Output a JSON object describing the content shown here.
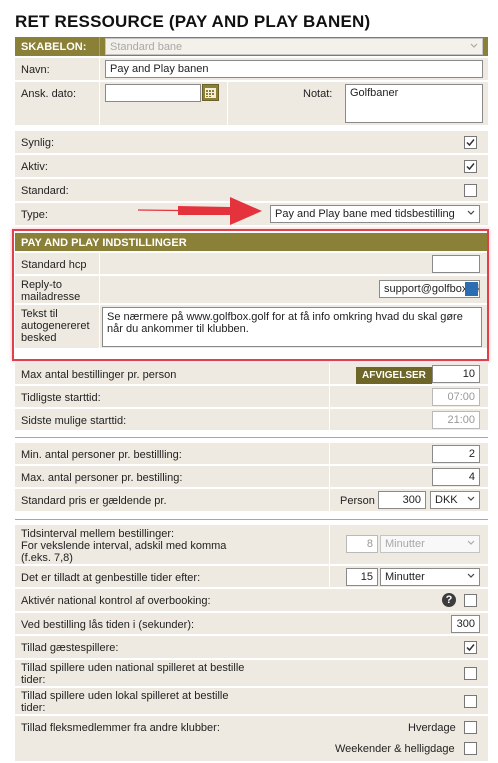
{
  "page": {
    "title": "RET RESSOURCE (PAY AND PLAY BANEN)"
  },
  "skabelon": {
    "label": "SKABELON:",
    "value": "Standard bane"
  },
  "navn": {
    "label": "Navn:",
    "value": "Pay and Play banen"
  },
  "ansk_dato": {
    "label": "Ansk. dato:",
    "value": ""
  },
  "notat": {
    "label": "Notat:",
    "value": "Golfbaner"
  },
  "synlig": {
    "label": "Synlig:",
    "checked": true
  },
  "aktiv": {
    "label": "Aktiv:",
    "checked": true
  },
  "standard": {
    "label": "Standard:",
    "checked": false
  },
  "type": {
    "label": "Type:",
    "value": "Pay and Play bane med tidsbestilling"
  },
  "pay_and_play": {
    "header": "PAY AND PLAY INDSTILLINGER",
    "standard_hcp": {
      "label": "Standard hcp",
      "value": ""
    },
    "reply_to": {
      "label_1": "Reply-to",
      "label_2": "mailadresse",
      "value": "support@golfbox.dk"
    },
    "tekst": {
      "label_1": "Tekst til",
      "label_2": "autogenereret",
      "label_3": "besked",
      "value_1": "Se nærmere på www.golfbox.golf for at få info omkring hvad du skal gøre",
      "value_2": "når du ankommer til klubben."
    }
  },
  "max_antal": {
    "label": "Max antal bestillinger pr. person",
    "badge": "AFVIGELSER",
    "value": "10"
  },
  "tidligste": {
    "label": "Tidligste starttid:",
    "value": "07:00"
  },
  "sidste": {
    "label": "Sidste mulige starttid:",
    "value": "21:00"
  },
  "min_personer": {
    "label": "Min. antal personer pr. bestillling:",
    "value": "2"
  },
  "max_personer": {
    "label": "Max. antal personer pr. bestilling:",
    "value": "4"
  },
  "pris": {
    "label": "Standard pris er gældende pr.",
    "unit_label": "Person",
    "value": "300",
    "currency": "DKK"
  },
  "tidsinterval": {
    "label_1": "Tidsinterval mellem bestillinger:",
    "label_2": "For vekslende interval, adskil med komma",
    "label_3": "(f.eks. 7,8)",
    "value": "8",
    "unit": "Minutter"
  },
  "genbestille": {
    "label": "Det er tilladt at genbestille tider efter:",
    "value": "15",
    "unit": "Minutter"
  },
  "national_kontrol": {
    "label": "Aktivér national kontrol af overbooking:",
    "help": "?",
    "checked": false
  },
  "laas": {
    "label": "Ved bestilling lås tiden i (sekunder):",
    "value": "300"
  },
  "gaester": {
    "label": "Tillad gæstespillere:",
    "checked": true
  },
  "uden_national": {
    "label_1": "Tillad spillere uden national spilleret at bestille",
    "label_2": "tider:",
    "checked": false
  },
  "uden_lokal": {
    "label_1": "Tillad spillere uden lokal spilleret at bestille",
    "label_2": "tider:",
    "checked": false
  },
  "fleks": {
    "label": "Tillad fleksmedlemmer fra andre klubber:",
    "hverdage_label": "Hverdage",
    "hverdage_checked": false,
    "weekend_label": "Weekender & helligdage",
    "weekend_checked": false
  },
  "colors": {
    "header_olive": "#8b8037",
    "row_bg": "#eeeae1",
    "highlight_red": "#e0404a",
    "arrow_red": "#e5333d"
  }
}
